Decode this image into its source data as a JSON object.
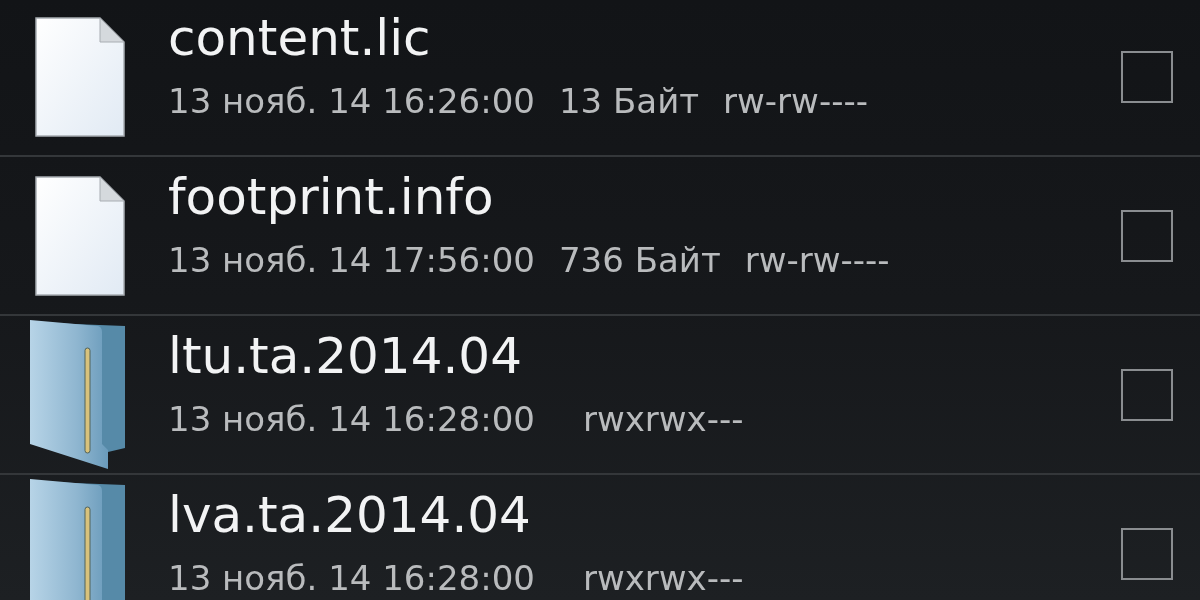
{
  "files": [
    {
      "kind": "file",
      "name": "content.lic",
      "date": "13 нояб. 14 16:26:00",
      "size": "13 Байт",
      "permissions": "rw-rw----",
      "checked": false
    },
    {
      "kind": "file",
      "name": "footprint.info",
      "date": "13 нояб. 14 17:56:00",
      "size": "736 Байт",
      "permissions": "rw-rw----",
      "checked": false
    },
    {
      "kind": "folder",
      "name": "ltu.ta.2014.04",
      "date": "13 нояб. 14 16:28:00",
      "permissions": "rwxrwx---",
      "checked": false
    },
    {
      "kind": "folder",
      "name": "lva.ta.2014.04",
      "date": "13 нояб. 14 16:28:00",
      "permissions": "rwxrwx---",
      "checked": false
    }
  ]
}
